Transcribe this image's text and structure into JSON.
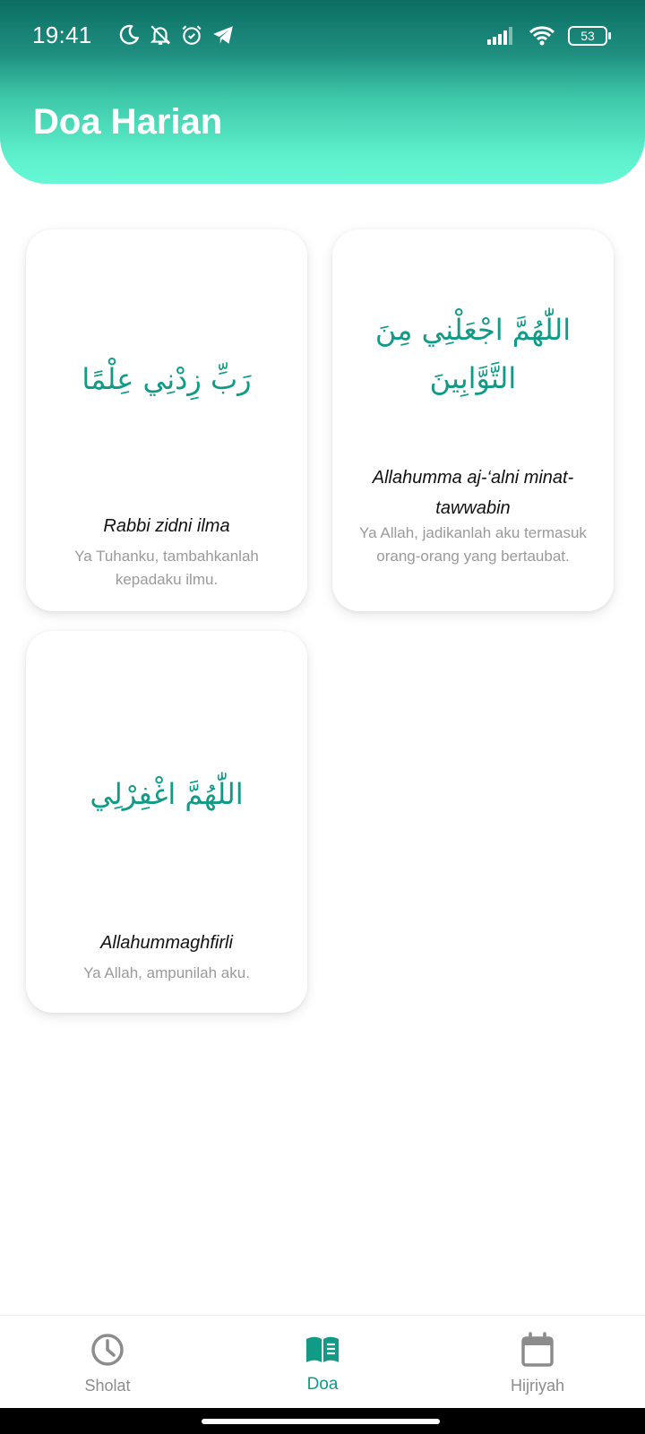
{
  "status_bar": {
    "time": "19:41",
    "battery": "53",
    "icons_left": [
      "moon-icon",
      "bell-off-icon",
      "alarm-icon",
      "telegram-icon"
    ],
    "icons_right": [
      "signal-icon",
      "wifi-icon",
      "battery-icon"
    ]
  },
  "header": {
    "title": "Doa Harian",
    "gradient_colors": [
      "#0b6e63",
      "#66f7d6"
    ]
  },
  "doa_list": [
    {
      "arabic": "رَبِّ زِدْنِي عِلْمًا",
      "latin": "Rabbi zidni ilma",
      "meaning": "Ya Tuhanku, tambahkanlah kepadaku ilmu."
    },
    {
      "arabic": "اللّٰهُمَّ اجْعَلْنِي مِنَ التَّوَّابِينَ",
      "latin": "Allahumma aj-‘alni minat-tawwabin",
      "meaning": "Ya Allah, jadikanlah aku termasuk orang-orang yang bertaubat."
    },
    {
      "arabic": "اللّٰهُمَّ اغْفِرْلِي",
      "latin": "Allahummaghfirli",
      "meaning": "Ya Allah, ampunilah aku."
    }
  ],
  "bottom_nav": {
    "items": [
      {
        "label": "Sholat",
        "icon": "clock-icon",
        "active": false
      },
      {
        "label": "Doa",
        "icon": "book-icon",
        "active": true
      },
      {
        "label": "Hijriyah",
        "icon": "calendar-icon",
        "active": false
      }
    ]
  },
  "colors": {
    "accent": "#119a86",
    "inactive": "#8c8c8c",
    "meaning_text": "#9a9a9a"
  }
}
